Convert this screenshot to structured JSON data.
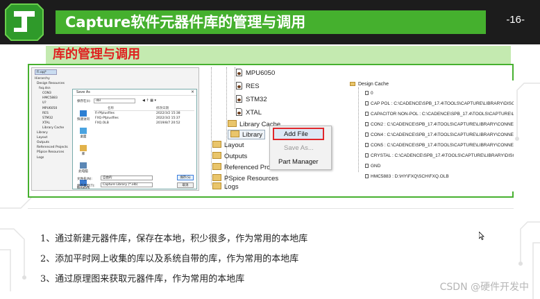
{
  "header": {
    "title": "Capture软件元器件库的管理与调用",
    "page_number": "-16-"
  },
  "subtitle": "库的管理与调用",
  "dialog_shot": {
    "tab": "Fi.opj*",
    "tree": [
      "Hierarchy",
      "Design Resources",
      "fxq.dsn",
      "CON3",
      "HMC5883",
      "U?",
      "MPU6050",
      "RES",
      "STM32",
      "XTAL",
      "Library Cache",
      "Library",
      "Layout",
      "Outputs",
      "Referenced Projects",
      "PSpice Resources",
      "Logs"
    ],
    "dialog_title": "Save As",
    "save_in_label": "保存在(I):",
    "save_in_value": "dbl",
    "places": [
      "快速访问",
      "桌面",
      "库",
      "此电脑",
      "Network"
    ],
    "columns": [
      "名称",
      "修改日期"
    ],
    "files": [
      {
        "name": "Fi-Pfplusfiles",
        "date": "2022/3/2 15:38"
      },
      {
        "name": "FXQ-Pfplusfiles",
        "date": "2022/3/2 15:37"
      },
      {
        "name": "FXQ.OLB",
        "date": "2019/8/7 20:52"
      }
    ],
    "filename_label": "文件名(N):",
    "filename_value": "自由的",
    "filetype_label": "保存类型(T):",
    "filetype_value": "Capture Library (*.olb)",
    "save_button": "保存(S)",
    "cancel_button": "取消"
  },
  "tree_shot": {
    "items": [
      "MPU6050",
      "RES",
      "STM32",
      "XTAL",
      "Library Cache",
      "Library",
      "Layout",
      "Outputs",
      "Referenced Pro",
      "PSpice Resources",
      "Logs"
    ],
    "context_menu": [
      "Add File",
      "Save As...",
      "Part Manager"
    ]
  },
  "cache_shot": {
    "root": "Design Cache",
    "entries": [
      "0",
      "CAP POL : C:\\CADENCE\\SPB_17.4\\TOOLS\\CAPTURE\\LIBRARY\\DISCRETE.OLB",
      "CAPACITOR NON-POL : C:\\CADENCE\\SPB_17.4\\TOOLS\\CAPTURE\\LIBRARY\\DI",
      "CON2 : C:\\CADENCE\\SPB_17.4\\TOOLS\\CAPTURE\\LIBRARY\\CONNECTOR.OLB",
      "CON4 : C:\\CADENCE\\SPB_17.4\\TOOLS\\CAPTURE\\LIBRARY\\CONNECTOR.OLB",
      "CON5 : C:\\CADENCE\\SPB_17.4\\TOOLS\\CAPTURE\\LIBRARY\\CONNECTOR.OLB",
      "CRYSTAL : C:\\CADENCE\\SPB_17.4\\TOOLS\\CAPTURE\\LIBRARY\\DISCRETE.OLB",
      "GND",
      "HMC5883 : D:\\HY\\FXQ\\SCH\\FXQ.OLB"
    ]
  },
  "points": [
    "1、通过新建元器件库，保存在本地，积少很多，作为常用的本地库",
    "2、添加平时网上收集的库以及系统自带的库，作为常用的本地库",
    "3、通过原理图来获取元器件库，作为常用的本地库"
  ],
  "watermark": "CSDN @硬件开发中",
  "colors": {
    "header_bg": "#1c1c1c",
    "accent_green": "#45b02e",
    "subtitle_bg": "#c4eab0",
    "subtitle_text": "#e02020",
    "highlight": "#e0262b"
  }
}
